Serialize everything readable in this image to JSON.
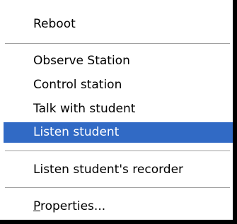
{
  "context_menu": {
    "items": [
      {
        "label": "Reboot"
      },
      {
        "label": "Observe Station"
      },
      {
        "label": "Control station"
      },
      {
        "label": "Talk with student"
      },
      {
        "label": "Listen student",
        "selected": true
      },
      {
        "label": "Listen student's recorder"
      },
      {
        "label_mnemonic": "P",
        "label_rest": "roperties..."
      }
    ]
  },
  "colors": {
    "selection_bg": "#316ac5",
    "selection_text": "#ffffff",
    "text": "#000000",
    "menu_bg": "#ffffff",
    "separator": "#a0a0a0"
  }
}
